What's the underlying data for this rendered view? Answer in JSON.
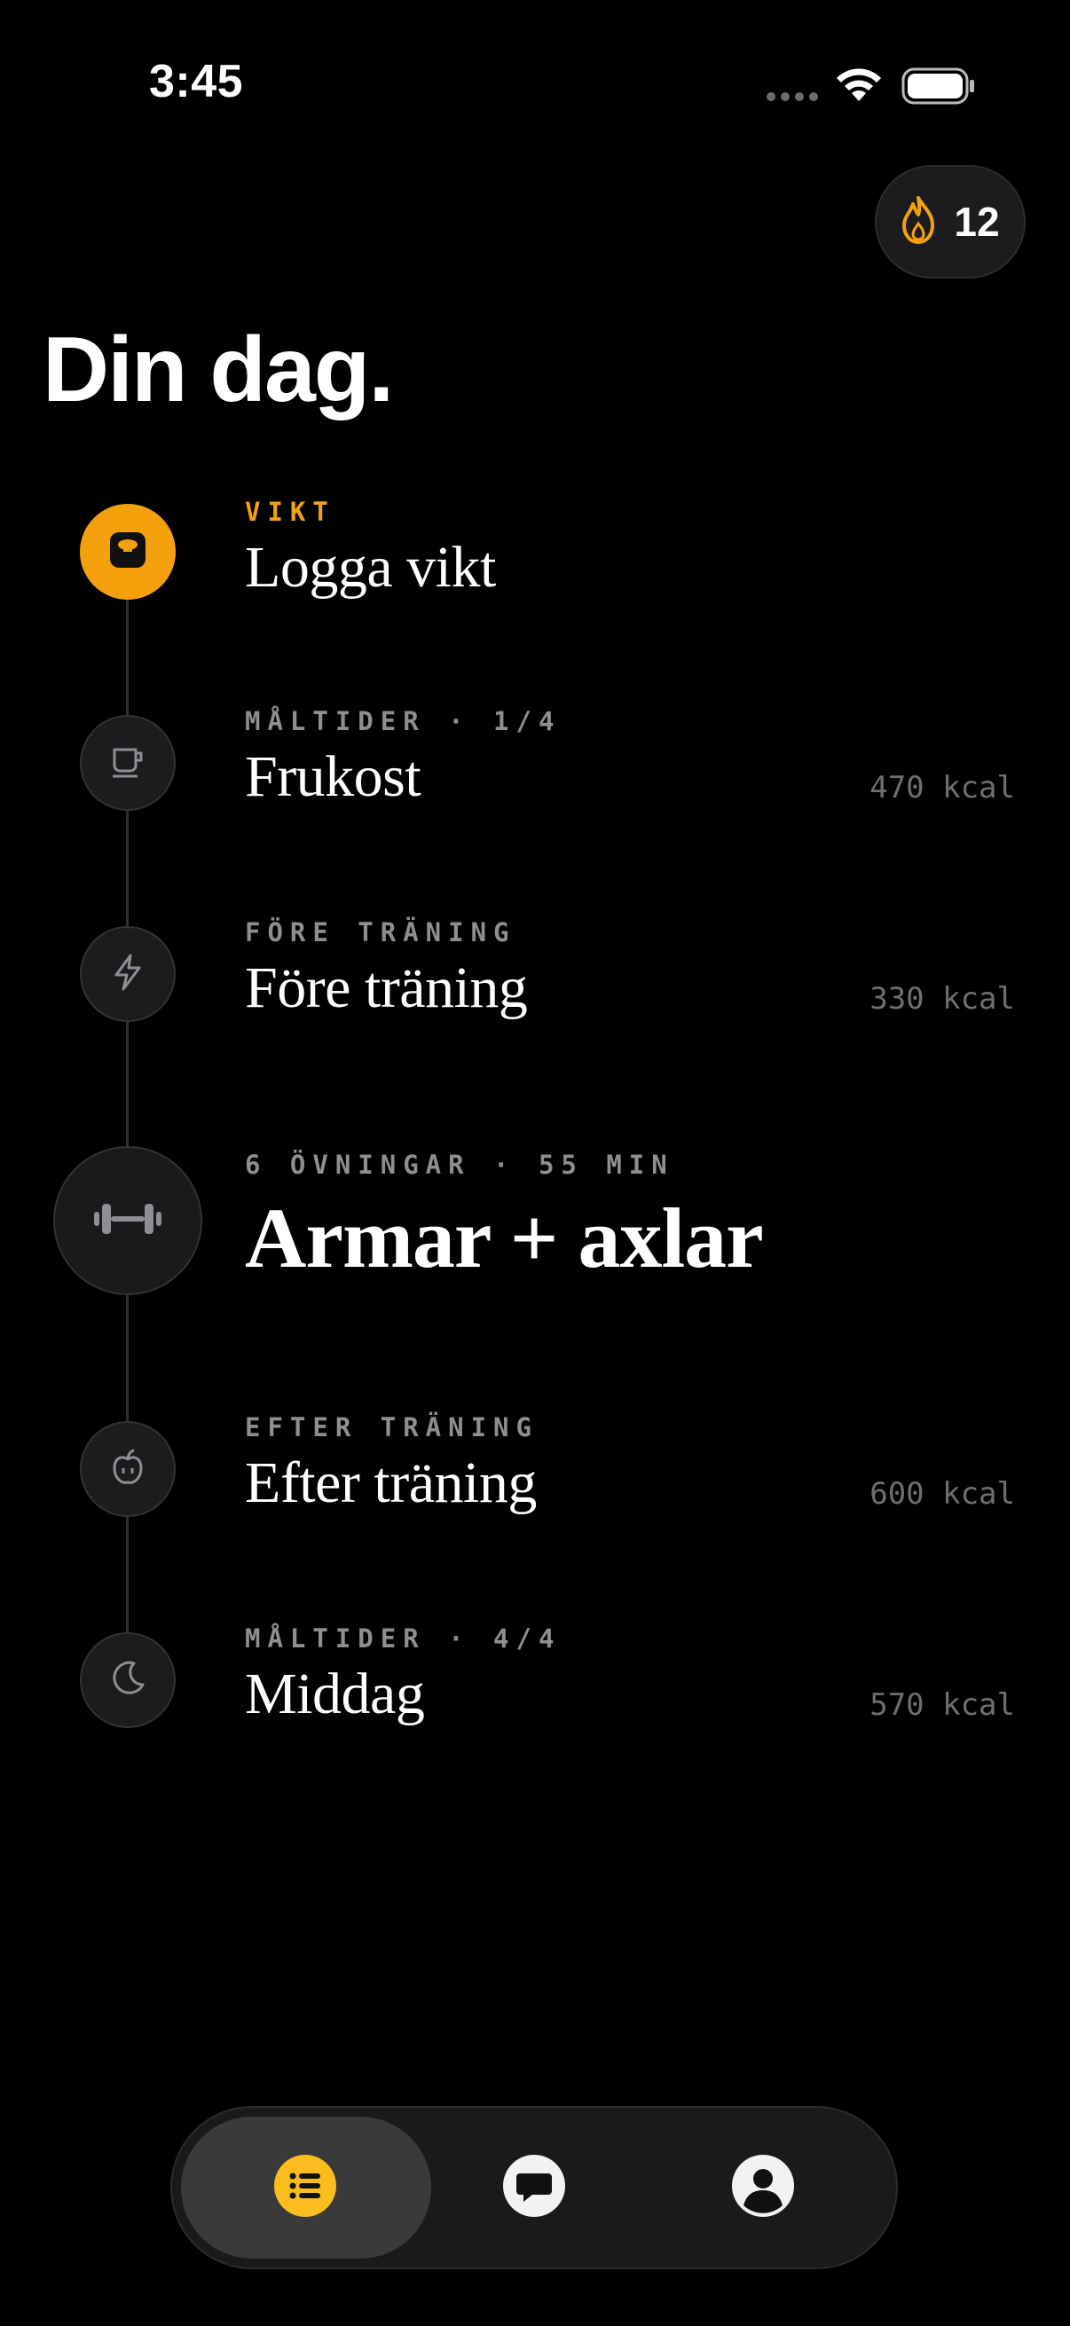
{
  "status_bar": {
    "time": "3:45"
  },
  "streak": {
    "count": "12",
    "icon": "flame-icon",
    "color": "#f5a10d"
  },
  "page_title": "Din dag.",
  "timeline": [
    {
      "icon": "weight-icon",
      "kicker": "VIKT",
      "title": "Logga vikt",
      "kcal": "",
      "active": true
    },
    {
      "icon": "cup-icon",
      "kicker": "MÅLTIDER · 1/4",
      "title": "Frukost",
      "kcal": "470 kcal",
      "active": false
    },
    {
      "icon": "bolt-icon",
      "kicker": "FÖRE TRÄNING",
      "title": "Före träning",
      "kcal": "330 kcal",
      "active": false
    },
    {
      "icon": "dumbbell-icon",
      "kicker": "6 ÖVNINGAR · 55 MIN",
      "title": "Armar + axlar",
      "kcal": "",
      "active": false
    },
    {
      "icon": "apple-icon",
      "kicker": "EFTER TRÄNING",
      "title": "Efter träning",
      "kcal": "600 kcal",
      "active": false
    },
    {
      "icon": "moon-icon",
      "kicker": "MÅLTIDER · 4/4",
      "title": "Middag",
      "kcal": "570 kcal",
      "active": false
    }
  ],
  "tabbar": {
    "tabs": [
      {
        "icon": "list-icon",
        "selected": true
      },
      {
        "icon": "chat-icon",
        "selected": false
      },
      {
        "icon": "profile-icon",
        "selected": false
      }
    ]
  },
  "colors": {
    "accent": "#f5a10d",
    "tab_accent": "#fbbd1e"
  }
}
